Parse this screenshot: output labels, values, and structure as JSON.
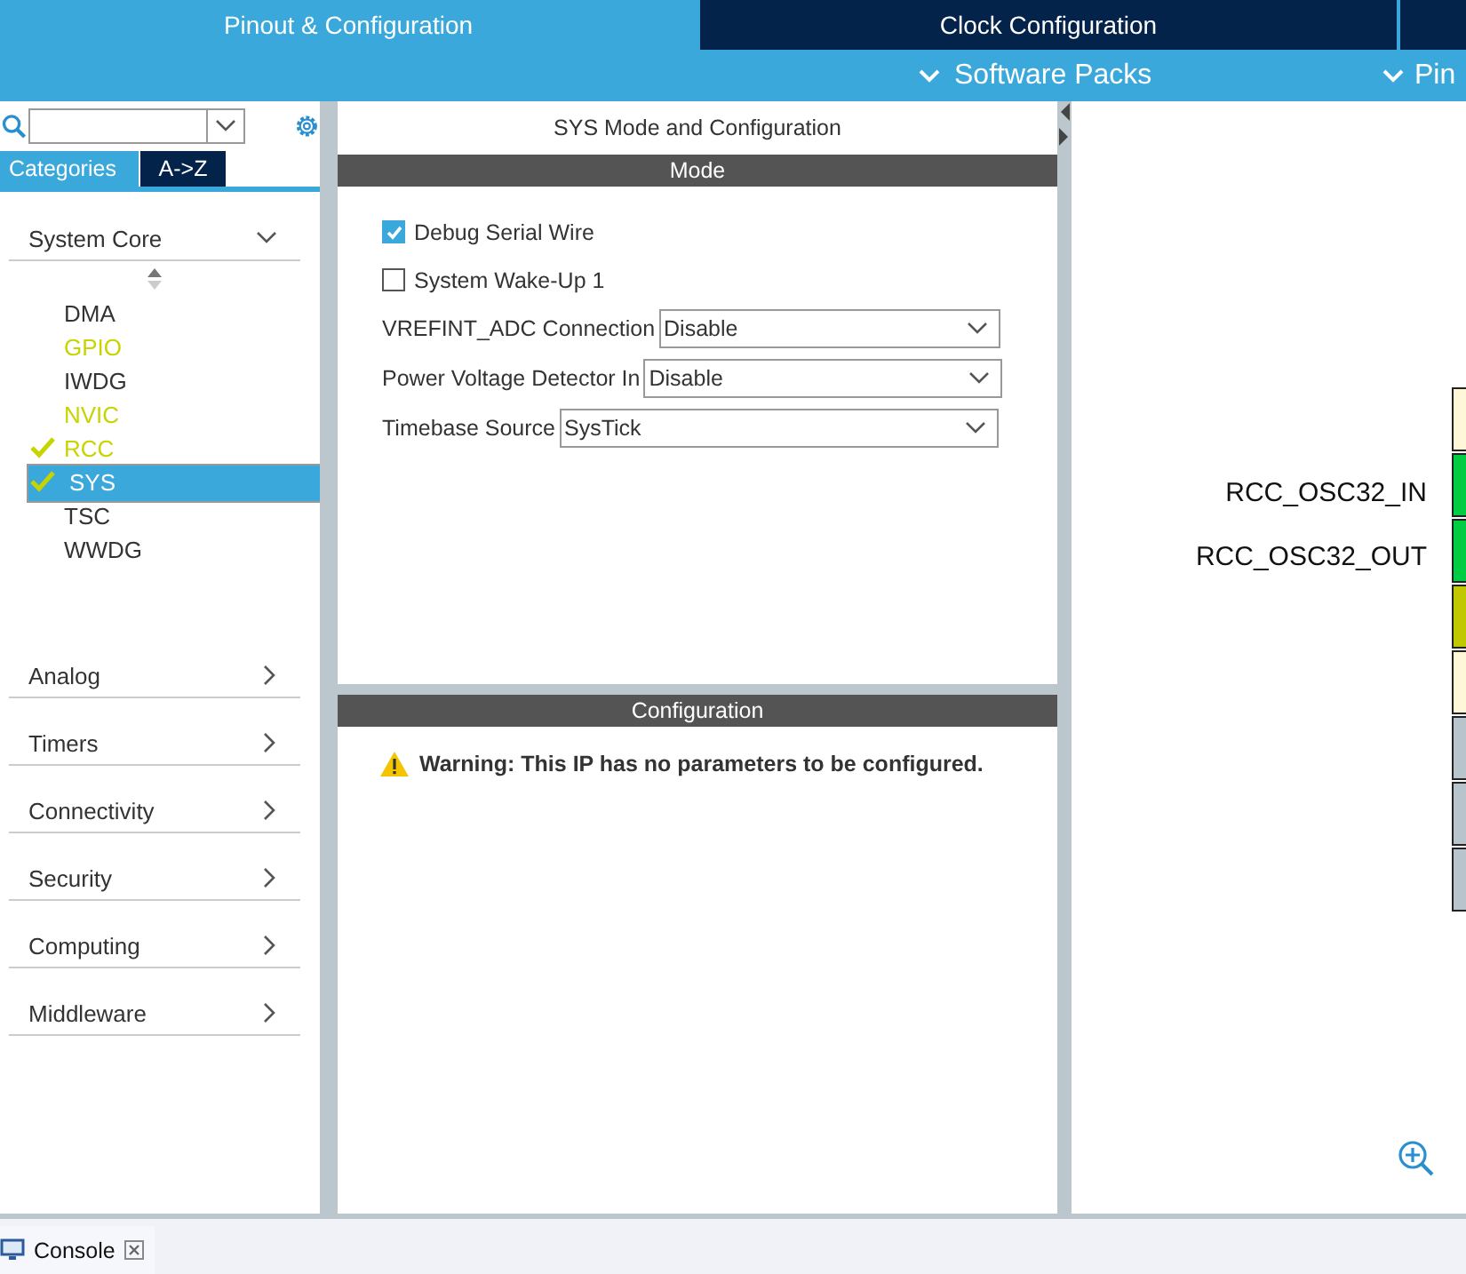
{
  "tabs": [
    {
      "label": "Pinout & Configuration",
      "selected": true
    },
    {
      "label": "Clock Configuration",
      "selected": false
    }
  ],
  "subtabs": [
    {
      "label": "Software Packs"
    },
    {
      "label": "Pin"
    }
  ],
  "sidebar": {
    "view_tabs": [
      {
        "label": "Categories",
        "selected": true
      },
      {
        "label": "A->Z",
        "selected": false
      }
    ],
    "categories": [
      {
        "label": "System Core",
        "expanded": true,
        "children": [
          {
            "label": "DMA",
            "configured": false,
            "checked": false,
            "selected": false
          },
          {
            "label": "GPIO",
            "configured": true,
            "checked": false,
            "selected": false
          },
          {
            "label": "IWDG",
            "configured": false,
            "checked": false,
            "selected": false
          },
          {
            "label": "NVIC",
            "configured": true,
            "checked": false,
            "selected": false
          },
          {
            "label": "RCC",
            "configured": true,
            "checked": true,
            "selected": false
          },
          {
            "label": "SYS",
            "configured": true,
            "checked": true,
            "selected": true
          },
          {
            "label": "TSC",
            "configured": false,
            "checked": false,
            "selected": false
          },
          {
            "label": "WWDG",
            "configured": false,
            "checked": false,
            "selected": false
          }
        ]
      },
      {
        "label": "Analog",
        "expanded": false
      },
      {
        "label": "Timers",
        "expanded": false
      },
      {
        "label": "Connectivity",
        "expanded": false
      },
      {
        "label": "Security",
        "expanded": false
      },
      {
        "label": "Computing",
        "expanded": false
      },
      {
        "label": "Middleware",
        "expanded": false
      }
    ]
  },
  "panel": {
    "title": "SYS Mode and Configuration",
    "mode_header": "Mode",
    "mode_items": [
      {
        "kind": "checkbox",
        "label": "Debug Serial Wire",
        "checked": true
      },
      {
        "kind": "checkbox",
        "label": "System Wake-Up 1",
        "checked": false
      },
      {
        "kind": "select",
        "label": "VREFINT_ADC Connection",
        "value": "Disable"
      },
      {
        "kind": "select",
        "label": "Power Voltage Detector In",
        "value": "Disable"
      },
      {
        "kind": "select",
        "label": "Timebase Source",
        "value": "SysTick"
      }
    ],
    "config_header": "Configuration",
    "warning": "Warning: This IP has no parameters to be configured."
  },
  "pinout": {
    "signals": [
      {
        "label": "RCC_OSC32_IN"
      },
      {
        "label": "RCC_OSC32_OUT"
      }
    ],
    "pins": [
      {
        "color": "#fff8d8"
      },
      {
        "color": "#00cc44"
      },
      {
        "color": "#00cc44"
      },
      {
        "color": "#c0c800"
      },
      {
        "color": "#fff8d8"
      },
      {
        "color": "#b8c4cc"
      },
      {
        "color": "#b8c4cc"
      },
      {
        "color": "#b8c4cc"
      }
    ]
  },
  "console": {
    "label": "Console"
  }
}
